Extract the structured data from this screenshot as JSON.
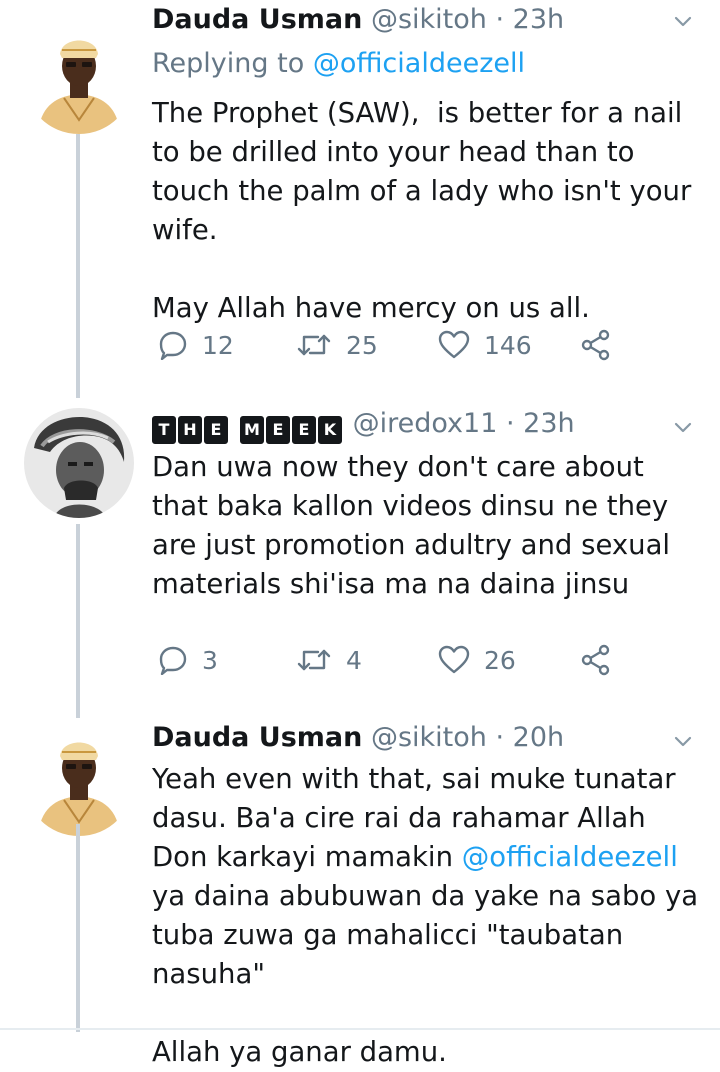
{
  "tweets": [
    {
      "name": "Dauda Usman",
      "handle": "@sikitoh",
      "dot": " · ",
      "time": "23h",
      "replying_prefix": "Replying to ",
      "replying_to": "@officialdeezell",
      "text": "The Prophet (SAW),  is better for a nail to be drilled into your head than to touch the palm of a lady who isn't your wife.\n\nMay Allah have mercy on us all.",
      "replies": "12",
      "retweets": "25",
      "likes": "146"
    },
    {
      "name_badges_1": [
        "T",
        "H",
        "E"
      ],
      "name_badges_2": [
        "M",
        "E",
        "E",
        "K"
      ],
      "handle": "@iredox11",
      "dot": " · ",
      "time": "23h",
      "text": "Dan uwa now they don't care about that baka kallon videos dinsu ne they are just promotion adultry and sexual materials shi'isa ma na daina jinsu",
      "replies": "3",
      "retweets": "4",
      "likes": "26"
    },
    {
      "name": "Dauda Usman",
      "handle": "@sikitoh",
      "dot": " · ",
      "time": "20h",
      "text_part1": "Yeah even with that, sai muke tunatar dasu. Ba'a cire rai da rahamar Allah Don karkayi mamakin ",
      "mention": "@officialdeezell",
      "text_part2": " ya daina abubuwan da yake na sabo ya tuba zuwa ga mahalicci \"taubatan nasuha\"\n\nAllah ya ganar damu."
    }
  ],
  "icons": {
    "reply": "reply-bubble-icon",
    "retweet": "retweet-icon",
    "like": "heart-icon",
    "share": "share-icon",
    "caret": "chevron-down-icon"
  },
  "colors": {
    "text": "#14171a",
    "muted": "#657786",
    "link": "#1da1f2",
    "thread_line": "#c9d1d9"
  }
}
